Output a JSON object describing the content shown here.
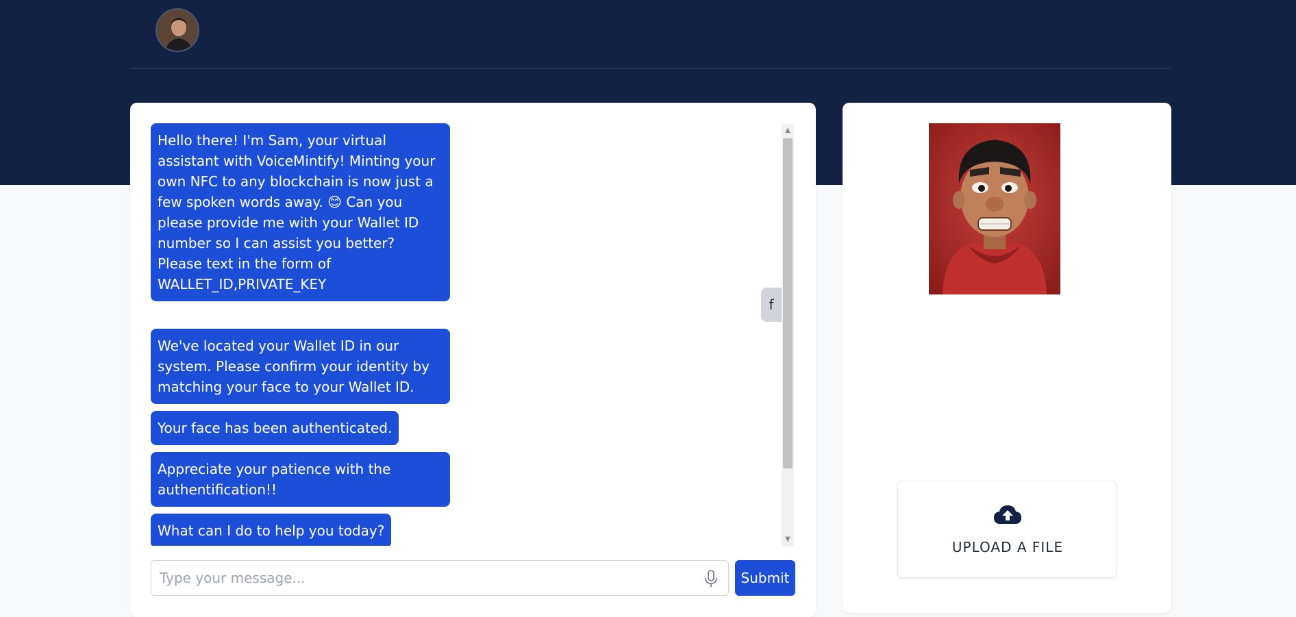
{
  "nav": {
    "avatar_alt": "User avatar"
  },
  "chat": {
    "messages": [
      {
        "sender": "bot",
        "text": "Hello there! I'm Sam, your virtual assistant with VoiceMintify! Minting your own NFC to any blockchain is now just a few spoken words away. 😊 Can you please provide me with your Wallet ID number so I can assist you better? Please text in the form of WALLET_ID,PRIVATE_KEY"
      },
      {
        "sender": "user",
        "text": "f"
      },
      {
        "sender": "bot",
        "text": "We've located your Wallet ID in our system. Please confirm your identity by matching your face to your Wallet ID."
      },
      {
        "sender": "bot",
        "text": "Your face has been authenticated."
      },
      {
        "sender": "bot",
        "text": "Appreciate your patience with the authentification!!"
      },
      {
        "sender": "bot",
        "text": "What can I do to help you today?"
      }
    ],
    "input": {
      "placeholder": "Type your message...",
      "value": ""
    },
    "submit_label": "Submit"
  },
  "side": {
    "character_alt": "Animated character portrait",
    "upload_label": "UPLOAD A FILE"
  },
  "colors": {
    "header_bg": "#132244",
    "bubble_bg": "#1d4ed8",
    "user_bubble_bg": "#d1d5db",
    "page_bg": "#f8f9fb"
  }
}
